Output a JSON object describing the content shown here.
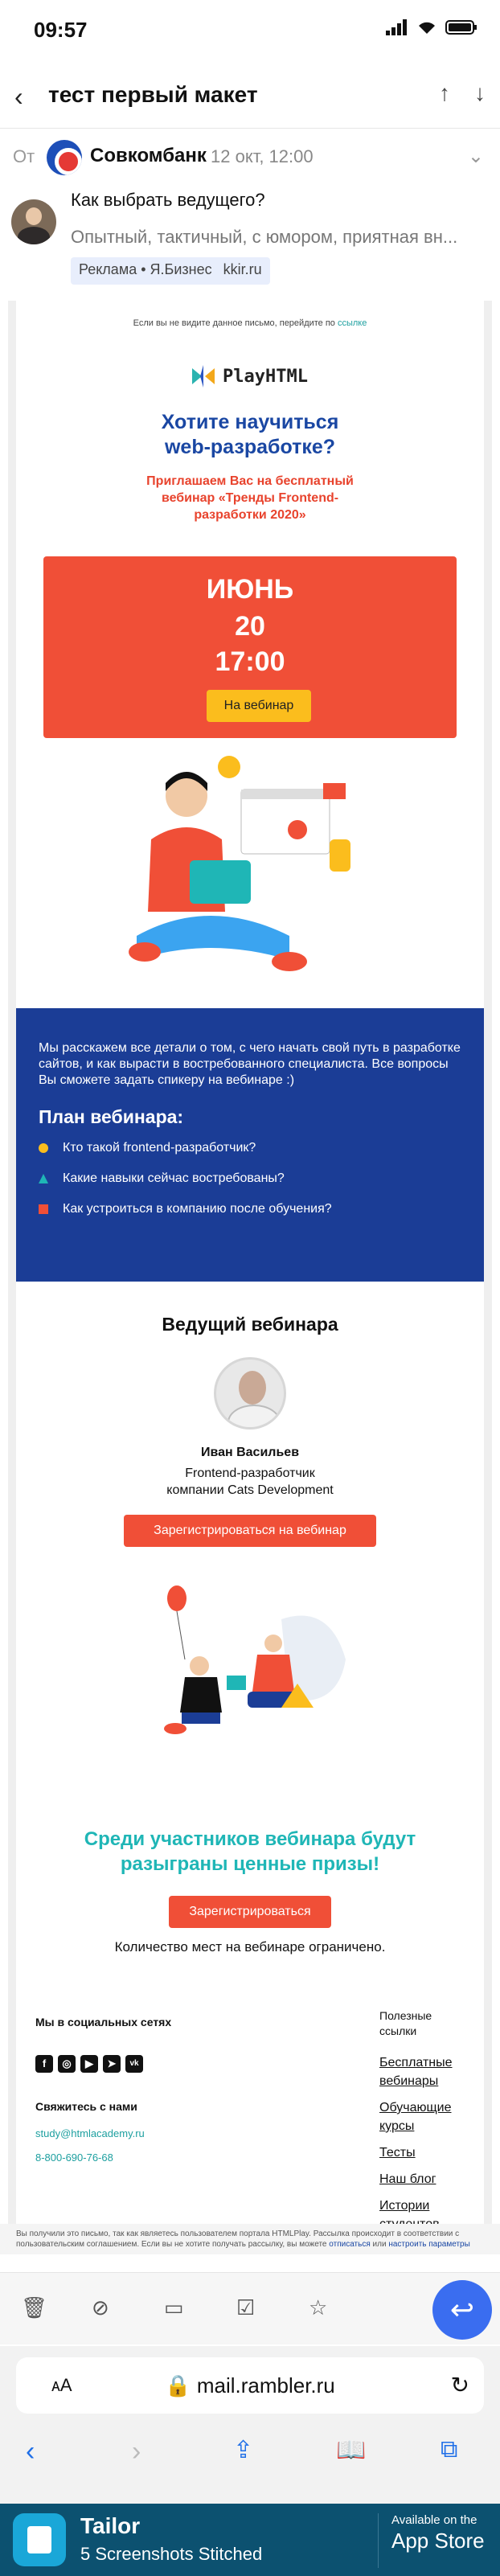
{
  "status": {
    "time": "09:57"
  },
  "nav": {
    "title": "тест первый макет"
  },
  "sender": {
    "from_label": "От",
    "name": "Совкомбанк",
    "date": "12 окт, 12:00"
  },
  "ad": {
    "title": "Как выбрать ведущего?",
    "text": "Опытный, тактичный, с юмором, приятная вн...",
    "tag": "Реклама • Я.Бизнес",
    "domain": "kkir.ru"
  },
  "email": {
    "preheader": "Если вы не видите данное письмо, перейдите по",
    "preheader_link": "ссылке",
    "brand": "PlayHTML",
    "hero_title": "Хотите научиться web-разработке?",
    "hero_sub": "Приглашаем Вас на бесплатный вебинар «Тренды Frontend-разработки 2020»",
    "month": "ИЮНЬ",
    "day": "20",
    "time": "17:00",
    "webinar_button": "На вебинар",
    "intro": "Мы расскажем все детали о том, с чего начать свой путь в разработке сайтов, и как вырасти в востребованного специалиста. Все вопросы Вы сможете задать спикеру на вебинаре :)",
    "plan_title": "План вебинара:",
    "plan_items": [
      "Кто такой frontend-разработчик?",
      "Какие навыки сейчас востребованы?",
      "Как устроиться в компанию после обучения?"
    ],
    "host_heading": "Ведущий вебинара",
    "host_name": "Иван Васильев",
    "host_role": "Frontend-разработчик компании Cats Development",
    "register_webinar": "Зарегистрироваться на вебинар",
    "prize_text": "Среди участников вебинара будут разыграны ценные призы!",
    "register": "Зарегистрироваться",
    "limited": "Количество мест на вебинаре ограничено.",
    "social_title": "Мы в социальных сетях",
    "contact_title": "Свяжитесь с нами",
    "contact_email": "study@htmlacademy.ru",
    "contact_phone": "8-800-690-76-68",
    "links_title": "Полезные ссылки",
    "links": [
      "Бесплатные вебинары",
      "Обучающие курсы",
      "Тесты",
      "Наш блог",
      "Истории студентов"
    ],
    "disclaimer": "Вы получили это письмо, так как являетесь пользователем портала HTMLPlay. Рассылка происходит в соответствии с пользовательским соглашением. Если вы не хотите получать рассылку, вы можете",
    "unsubscribe": "отписаться",
    "disclaimer_or": "или",
    "settings": "настроить параметры"
  },
  "browser": {
    "aa": "ᴀA",
    "url": "mail.rambler.ru"
  },
  "banner": {
    "app": "Tailor",
    "subtitle": "5 Screenshots Stitched",
    "available": "Available on the",
    "store": "App Store"
  },
  "colors": {
    "blue": "#1b3d96",
    "red": "#f04f37",
    "yellow": "#fbbd1d",
    "teal": "#1fb6b6"
  }
}
